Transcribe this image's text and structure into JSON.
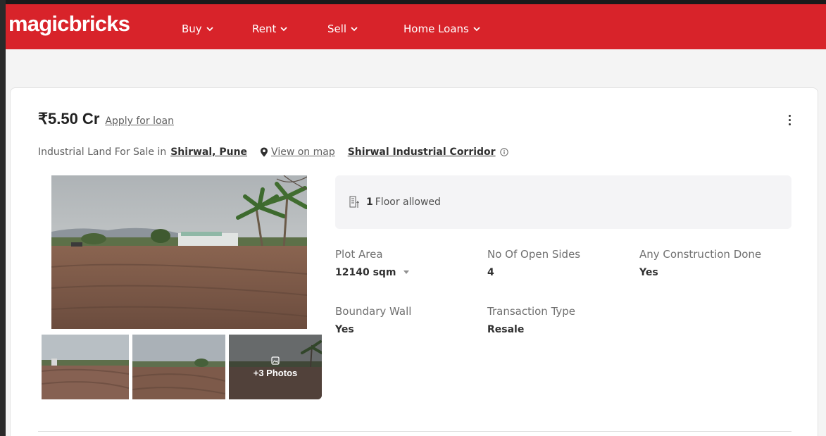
{
  "header": {
    "logo": "magicbricks",
    "nav": [
      "Buy",
      "Rent",
      "Sell",
      "Home Loans"
    ],
    "brand_color": "#d8232a"
  },
  "listing": {
    "price": "₹5.50 Cr",
    "apply_loan": "Apply for loan",
    "type_text": "Industrial Land For Sale in",
    "location": "Shirwal, Pune",
    "view_map": "View on map",
    "corridor": "Shirwal Industrial Corridor",
    "more_photos": "+3 Photos",
    "floor": {
      "count": "1",
      "text": "Floor allowed"
    },
    "attributes": {
      "plot_area": {
        "label": "Plot Area",
        "value": "12140 sqm"
      },
      "open_sides": {
        "label": "No Of Open Sides",
        "value": "4"
      },
      "construction": {
        "label": "Any Construction Done",
        "value": "Yes"
      },
      "boundary_wall": {
        "label": "Boundary Wall",
        "value": "Yes"
      },
      "transaction": {
        "label": "Transaction Type",
        "value": "Resale"
      }
    }
  },
  "icons": {
    "nav_chevron": "chevron-down-icon",
    "map": "map-pin-icon",
    "info": "info-icon",
    "floor": "building-floor-icon",
    "photos": "image-icon",
    "menu": "kebab-menu-icon"
  }
}
